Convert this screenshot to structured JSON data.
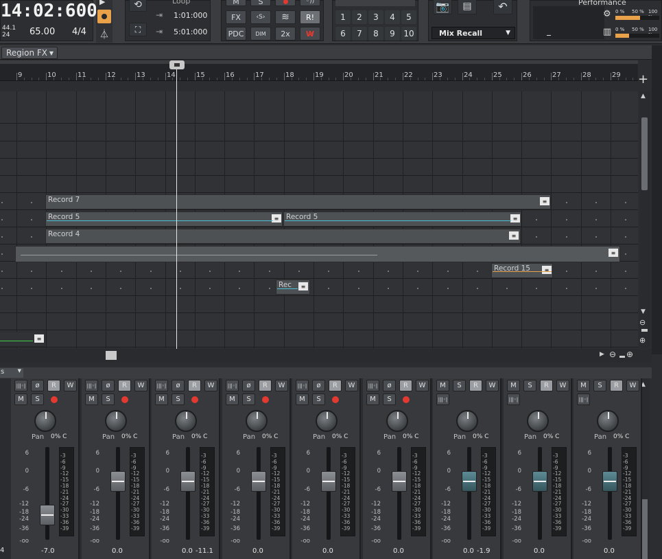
{
  "transport": {
    "time": "14:02:600",
    "sample_rate": "44.1",
    "bit_depth": "24",
    "tempo": "65.00",
    "meter": "4/4"
  },
  "loop": {
    "label": "Loop",
    "start": "1:01:000",
    "end": "5:01:000"
  },
  "mix_buttons": {
    "m": "M",
    "s": "S",
    "fx": "FX",
    "pdc": "PDC",
    "dim": "DIM",
    "x2": "2x",
    "r_bang": "R!"
  },
  "screensets": [
    "1",
    "2",
    "3",
    "4",
    "5",
    "6",
    "7",
    "8",
    "9",
    "10"
  ],
  "mix_recall": "Mix Recall",
  "performance": {
    "label": "Performance",
    "row1": {
      "pct0": "0 %",
      "pct50": "50 %",
      "pct100": "100 %"
    },
    "row2": {
      "pct0": "0 %",
      "pct50": "50 %",
      "pct100": "100 %"
    }
  },
  "region_fx": "Region FX",
  "ruler_numbers": [
    "9",
    "10",
    "11",
    "12",
    "13",
    "14",
    "15",
    "16",
    "17",
    "18",
    "19",
    "20",
    "21",
    "22",
    "23",
    "24",
    "25",
    "26",
    "27",
    "28",
    "29"
  ],
  "clips": {
    "record7": "Record 7",
    "record5a": "Record 5",
    "record5b": "Record 5",
    "record4": "Record 4",
    "record15": "Record 15",
    "rec": "Rec"
  },
  "console": {
    "header": "s",
    "pan_label": "Pan",
    "strips": [
      {
        "pan": "0% C",
        "val_left": "",
        "val_right": "-7.0",
        "arm": true
      },
      {
        "pan": "0% C",
        "val_left": "",
        "val_right": "0.0",
        "arm": true
      },
      {
        "pan": "0% C",
        "val_left": "0.0",
        "val_right": "-11.1",
        "arm": true
      },
      {
        "pan": "0% C",
        "val_left": "",
        "val_right": "0.0",
        "arm": true
      },
      {
        "pan": "0% C",
        "val_left": "",
        "val_right": "0.0",
        "arm": true
      },
      {
        "pan": "0% C",
        "val_left": "",
        "val_right": "0.0",
        "arm": true
      },
      {
        "pan": "0% C",
        "val_left": "0.0",
        "val_right": "-1.9",
        "arm": false
      },
      {
        "pan": "0% C",
        "val_left": "",
        "val_right": "0.0",
        "arm": false
      },
      {
        "pan": "0% C",
        "val_left": "",
        "val_right": "0.0",
        "arm": false
      }
    ],
    "fader_scale": [
      "6",
      "0",
      "-6",
      "-12",
      "-18",
      "-24",
      "-36",
      "-oo"
    ],
    "meter_scale": [
      "-3",
      "-6",
      "-9",
      "-12",
      "-15",
      "-18",
      "-21",
      "-24",
      "-27",
      "-30",
      "-33",
      "-36",
      "-39"
    ],
    "first_strip_edge_value": "4",
    "btn_m": "M",
    "btn_s": "S",
    "btn_r": "R",
    "btn_w": "W"
  }
}
